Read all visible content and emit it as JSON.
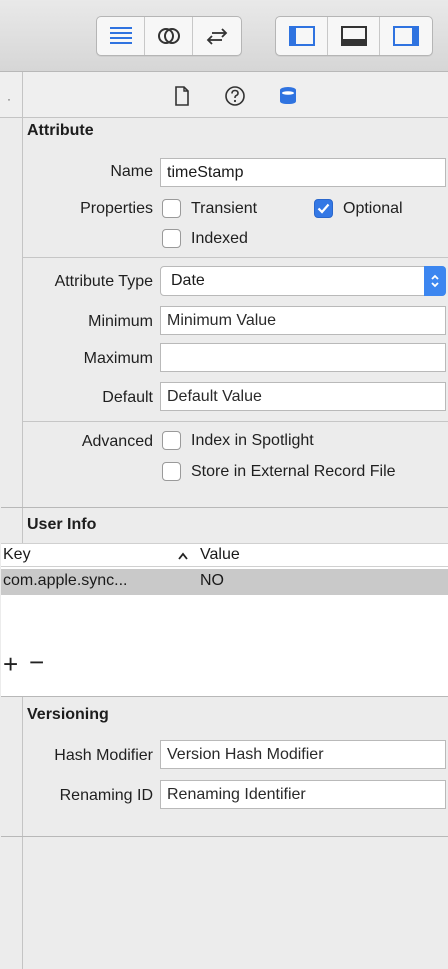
{
  "toolbar": {
    "left_group": [
      "standard-editor-icon",
      "assistant-editor-icon",
      "version-editor-icon"
    ],
    "right_group": [
      "navigator-toggle-icon",
      "debug-area-toggle-icon",
      "utilities-toggle-icon"
    ]
  },
  "inspector_tabs": [
    "file-inspector-icon",
    "quick-help-icon",
    "data-model-inspector-icon"
  ],
  "attribute": {
    "section_title": "Attribute",
    "name_label": "Name",
    "name_value": "timeStamp",
    "properties_label": "Properties",
    "transient_label": "Transient",
    "transient_checked": false,
    "optional_label": "Optional",
    "optional_checked": true,
    "indexed_label": "Indexed",
    "indexed_checked": false,
    "type_label": "Attribute Type",
    "type_value": "Date",
    "minimum_label": "Minimum",
    "minimum_placeholder": "Minimum Value",
    "maximum_label": "Maximum",
    "maximum_value": "",
    "default_label": "Default",
    "default_placeholder": "Default Value",
    "advanced_label": "Advanced",
    "spotlight_label": "Index in Spotlight",
    "spotlight_checked": false,
    "external_label": "Store in External Record File",
    "external_checked": false
  },
  "user_info": {
    "section_title": "User Info",
    "col_key": "Key",
    "col_value": "Value",
    "rows": [
      {
        "key": "com.apple.sync...",
        "value": "NO"
      }
    ],
    "add_label": "+",
    "remove_label": "−"
  },
  "versioning": {
    "section_title": "Versioning",
    "hash_label": "Hash Modifier",
    "hash_placeholder": "Version Hash Modifier",
    "renaming_label": "Renaming ID",
    "renaming_placeholder": "Renaming Identifier"
  },
  "colors": {
    "accent": "#3478e5",
    "selected_row": "#c9c9c9",
    "panel_bg": "#ececec"
  }
}
